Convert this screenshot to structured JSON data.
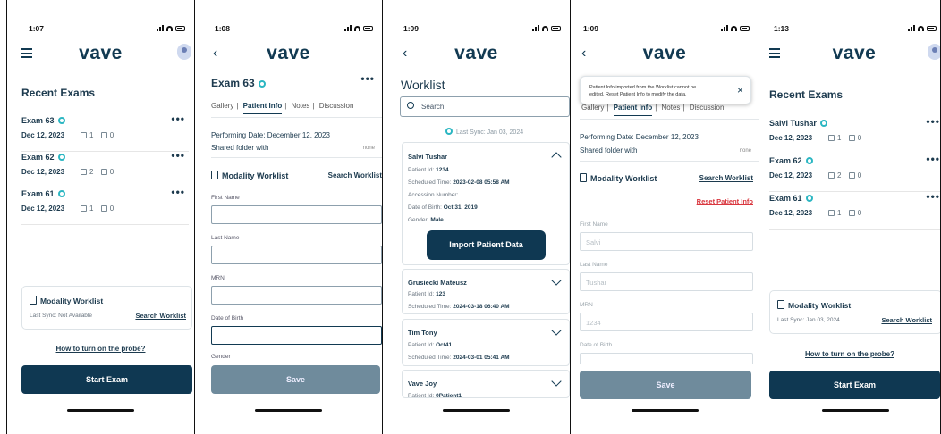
{
  "brand": "vave",
  "screen1": {
    "time": "1:07",
    "title": "Recent Exams",
    "exams": [
      {
        "name": "Exam 63",
        "date": "Dec 12, 2023",
        "images": "1",
        "clips": "0"
      },
      {
        "name": "Exam 62",
        "date": "Dec 12, 2023",
        "images": "2",
        "clips": "0"
      },
      {
        "name": "Exam 61",
        "date": "Dec 12, 2023",
        "images": "1",
        "clips": "0"
      }
    ],
    "worklist_title": "Modality Worklist",
    "last_sync": "Last Sync: Not Available",
    "search_worklist": "Search Worklist",
    "probe_link": "How to turn on the probe?",
    "start_button": "Start Exam"
  },
  "screen2": {
    "time": "1:08",
    "exam_title": "Exam 63",
    "tabs": [
      "Gallery",
      "Patient Info",
      "Notes",
      "Discussion"
    ],
    "tab_separator": "|",
    "performing_date": "Performing Date: December 12, 2023",
    "shared_folder": "Shared folder with",
    "shared_value": "none",
    "worklist_title": "Modality Worklist",
    "search_worklist": "Search Worklist",
    "fields": [
      "First Name",
      "Last Name",
      "MRN",
      "Date of Birth",
      "Gender"
    ],
    "save_button": "Save"
  },
  "screen3": {
    "time": "1:09",
    "title": "Worklist",
    "search_placeholder": "Search",
    "last_sync": "Last Sync: Jan 03, 2024",
    "patient_id_label": "Patient Id:",
    "scheduled_label": "Scheduled Time:",
    "accession_label": "Accession Number:",
    "dob_label": "Date of Birth:",
    "gender_label": "Gender:",
    "expanded": {
      "name": "Salvi Tushar",
      "patient_id": "1234",
      "scheduled": "2023-02-08 05:58 AM",
      "dob": "Oct 31, 2019",
      "gender": "Male"
    },
    "import_button": "Import Patient Data",
    "patients": [
      {
        "name": "Grusiecki Mateusz",
        "patient_id": "123",
        "scheduled": "2024-03-18 06:40 AM"
      },
      {
        "name": "Tim Tony",
        "patient_id": "Oct41",
        "scheduled": "2024-03-01 05:41 AM"
      },
      {
        "name": "Vave Joy",
        "patient_id": "0Patient1",
        "scheduled": ""
      }
    ]
  },
  "screen4": {
    "time": "1:09",
    "toast_line1": "Patient Info imported from the Worklist cannot be",
    "toast_line2": "edited. Reset Patient Info to modify the data.",
    "tabs": [
      "Gallery",
      "Patient Info",
      "Notes",
      "Discussion"
    ],
    "tab_separator": "|",
    "performing_date": "Performing Date: December 12, 2023",
    "shared_folder": "Shared folder with",
    "shared_value": "none",
    "worklist_title": "Modality Worklist",
    "search_worklist": "Search Worklist",
    "reset_link": "Reset Patient Info",
    "fields": [
      {
        "label": "First Name",
        "value": "Salvi"
      },
      {
        "label": "Last Name",
        "value": "Tushar"
      },
      {
        "label": "MRN",
        "value": "1234"
      },
      {
        "label": "Date of Birth",
        "value": ""
      }
    ],
    "save_button": "Save"
  },
  "screen5": {
    "time": "1:13",
    "title": "Recent Exams",
    "exams": [
      {
        "name": "Salvi Tushar",
        "date": "Dec 12, 2023",
        "images": "1",
        "clips": "0"
      },
      {
        "name": "Exam 62",
        "date": "Dec 12, 2023",
        "images": "2",
        "clips": "0"
      },
      {
        "name": "Exam 61",
        "date": "Dec 12, 2023",
        "images": "1",
        "clips": "0"
      }
    ],
    "worklist_title": "Modality Worklist",
    "last_sync": "Last Sync: Jan 03, 2024",
    "search_worklist": "Search Worklist",
    "probe_link": "How to turn on the probe?",
    "start_button": "Start Exam"
  },
  "colors": {
    "primary": "#0f3852",
    "accent": "#2bb6c2",
    "disabled": "#6f8b9c",
    "danger": "#d9363e"
  },
  "icons": [
    "menu-icon",
    "back-icon",
    "avatar-icon",
    "probe-icon",
    "image-count-icon",
    "clip-count-icon",
    "search-icon",
    "chevron-icon",
    "close-icon",
    "worklist-icon",
    "sync-icon"
  ]
}
